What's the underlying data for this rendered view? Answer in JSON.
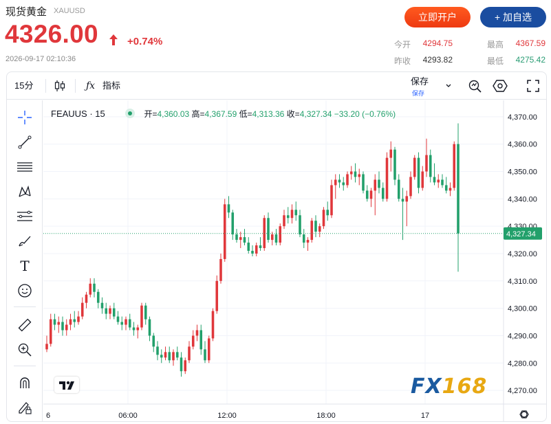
{
  "quote": {
    "name": "现货黄金",
    "symbol": "XAUUSD",
    "price": "4326.00",
    "change_pct": "+0.74%",
    "datetime": "2026-09-17 02:10:36"
  },
  "buttons": {
    "open_account": "立即开户",
    "add_watchlist": "+ 加自选"
  },
  "stats": {
    "open_label": "今开",
    "open": "4294.75",
    "high_label": "最高",
    "high": "4367.59",
    "prev_close_label": "昨收",
    "prev_close": "4293.82",
    "low_label": "最低",
    "low": "4275.42"
  },
  "toolbar": {
    "interval": "15分",
    "indicators": "指标",
    "save": "保存",
    "save_sub": "保存"
  },
  "legend": {
    "symbol": "FEAUUS · 15",
    "open_label": "开=",
    "open": "4,360.03",
    "high_label": "高=",
    "high": "4,367.59",
    "low_label": "低=",
    "low": "4,313.36",
    "close_label": "收=",
    "close": "4,327.34",
    "change": "−33.20 (−0.76%)"
  },
  "watermark": {
    "fx": "FX",
    "num": "168"
  },
  "colors": {
    "up": "#e0373b",
    "down": "#22a06b",
    "grid": "#f0f3fa",
    "price_line": "#22a06b"
  },
  "chart_data": {
    "type": "candlestick",
    "y_ticks": [
      "4,370.00",
      "4,360.00",
      "4,350.00",
      "4,340.00",
      "4,330.00",
      "4,320.00",
      "4,310.00",
      "4,300.00",
      "4,290.00",
      "4,280.00",
      "4,270.00"
    ],
    "ylim": [
      4265,
      4376
    ],
    "x_ticks": [
      "6",
      "06:00",
      "12:00",
      "18:00",
      "17"
    ],
    "last_price_label": "4,327.34",
    "last_price": 4327.34,
    "candles": [
      [
        4285,
        4290,
        4284,
        4287
      ],
      [
        4287,
        4298,
        4286,
        4296
      ],
      [
        4296,
        4298,
        4292,
        4294
      ],
      [
        4294,
        4297,
        4291,
        4295
      ],
      [
        4295,
        4297,
        4290,
        4292
      ],
      [
        4292,
        4296,
        4290,
        4294
      ],
      [
        4294,
        4298,
        4292,
        4296
      ],
      [
        4296,
        4299,
        4293,
        4295
      ],
      [
        4295,
        4299,
        4294,
        4297
      ],
      [
        4297,
        4304,
        4296,
        4302
      ],
      [
        4302,
        4306,
        4300,
        4305
      ],
      [
        4305,
        4311,
        4304,
        4309
      ],
      [
        4309,
        4311,
        4304,
        4306
      ],
      [
        4306,
        4307,
        4300,
        4302
      ],
      [
        4302,
        4304,
        4298,
        4300
      ],
      [
        4300,
        4302,
        4296,
        4298
      ],
      [
        4298,
        4301,
        4296,
        4300
      ],
      [
        4300,
        4302,
        4296,
        4297
      ],
      [
        4297,
        4299,
        4294,
        4295
      ],
      [
        4295,
        4297,
        4292,
        4294
      ],
      [
        4294,
        4297,
        4292,
        4296
      ],
      [
        4296,
        4298,
        4292,
        4293
      ],
      [
        4293,
        4295,
        4290,
        4292
      ],
      [
        4292,
        4294,
        4289,
        4293
      ],
      [
        4293,
        4302,
        4292,
        4301
      ],
      [
        4301,
        4302,
        4294,
        4296
      ],
      [
        4296,
        4297,
        4288,
        4290
      ],
      [
        4290,
        4291,
        4284,
        4286
      ],
      [
        4286,
        4288,
        4281,
        4283
      ],
      [
        4283,
        4285,
        4280,
        4282
      ],
      [
        4282,
        4286,
        4281,
        4284
      ],
      [
        4284,
        4286,
        4280,
        4281
      ],
      [
        4281,
        4285,
        4279,
        4284
      ],
      [
        4284,
        4286,
        4281,
        4282
      ],
      [
        4282,
        4284,
        4275,
        4277
      ],
      [
        4277,
        4282,
        4276,
        4281
      ],
      [
        4281,
        4288,
        4280,
        4286
      ],
      [
        4286,
        4292,
        4285,
        4290
      ],
      [
        4290,
        4294,
        4288,
        4292
      ],
      [
        4292,
        4294,
        4283,
        4285
      ],
      [
        4285,
        4288,
        4280,
        4281
      ],
      [
        4281,
        4290,
        4280,
        4289
      ],
      [
        4289,
        4300,
        4288,
        4299
      ],
      [
        4299,
        4312,
        4298,
        4310
      ],
      [
        4310,
        4320,
        4309,
        4318
      ],
      [
        4318,
        4340,
        4317,
        4338
      ],
      [
        4338,
        4341,
        4333,
        4335
      ],
      [
        4335,
        4336,
        4325,
        4327
      ],
      [
        4327,
        4329,
        4324,
        4325
      ],
      [
        4325,
        4328,
        4322,
        4326
      ],
      [
        4326,
        4329,
        4323,
        4324
      ],
      [
        4324,
        4326,
        4320,
        4321
      ],
      [
        4321,
        4323,
        4319,
        4320
      ],
      [
        4320,
        4324,
        4319,
        4323
      ],
      [
        4323,
        4326,
        4321,
        4322
      ],
      [
        4322,
        4334,
        4321,
        4333
      ],
      [
        4333,
        4335,
        4324,
        4325
      ],
      [
        4325,
        4328,
        4323,
        4327
      ],
      [
        4327,
        4329,
        4323,
        4324
      ],
      [
        4324,
        4331,
        4323,
        4330
      ],
      [
        4330,
        4336,
        4329,
        4334
      ],
      [
        4334,
        4337,
        4331,
        4333
      ],
      [
        4333,
        4338,
        4331,
        4336
      ],
      [
        4336,
        4339,
        4332,
        4334
      ],
      [
        4334,
        4336,
        4326,
        4327
      ],
      [
        4327,
        4329,
        4322,
        4324
      ],
      [
        4324,
        4326,
        4321,
        4325
      ],
      [
        4325,
        4333,
        4324,
        4332
      ],
      [
        4332,
        4334,
        4326,
        4328
      ],
      [
        4328,
        4331,
        4326,
        4330
      ],
      [
        4330,
        4337,
        4329,
        4336
      ],
      [
        4336,
        4339,
        4332,
        4334
      ],
      [
        4334,
        4347,
        4333,
        4345
      ],
      [
        4345,
        4349,
        4340,
        4347
      ],
      [
        4347,
        4349,
        4344,
        4346
      ],
      [
        4346,
        4348,
        4343,
        4345
      ],
      [
        4345,
        4350,
        4344,
        4349
      ],
      [
        4349,
        4352,
        4347,
        4350
      ],
      [
        4350,
        4353,
        4346,
        4348
      ],
      [
        4348,
        4351,
        4345,
        4349
      ],
      [
        4349,
        4350,
        4342,
        4343
      ],
      [
        4343,
        4345,
        4339,
        4340
      ],
      [
        4340,
        4344,
        4337,
        4343
      ],
      [
        4343,
        4349,
        4334,
        4347
      ],
      [
        4347,
        4350,
        4342,
        4344
      ],
      [
        4344,
        4346,
        4339,
        4340
      ],
      [
        4340,
        4357,
        4339,
        4355
      ],
      [
        4355,
        4361,
        4350,
        4358
      ],
      [
        4358,
        4359,
        4345,
        4347
      ],
      [
        4347,
        4349,
        4339,
        4340
      ],
      [
        4340,
        4344,
        4325,
        4339
      ],
      [
        4339,
        4343,
        4330,
        4341
      ],
      [
        4341,
        4350,
        4340,
        4348
      ],
      [
        4348,
        4356,
        4347,
        4355
      ],
      [
        4355,
        4357,
        4342,
        4344
      ],
      [
        4344,
        4352,
        4343,
        4350
      ],
      [
        4350,
        4362,
        4348,
        4356
      ],
      [
        4356,
        4358,
        4346,
        4348
      ],
      [
        4348,
        4353,
        4345,
        4346
      ],
      [
        4346,
        4349,
        4344,
        4347
      ],
      [
        4347,
        4349,
        4344,
        4345
      ],
      [
        4345,
        4348,
        4342,
        4343
      ],
      [
        4343,
        4346,
        4341,
        4344
      ],
      [
        4344,
        4361,
        4343,
        4360
      ],
      [
        4360.03,
        4367.59,
        4313.36,
        4327.34
      ]
    ]
  }
}
